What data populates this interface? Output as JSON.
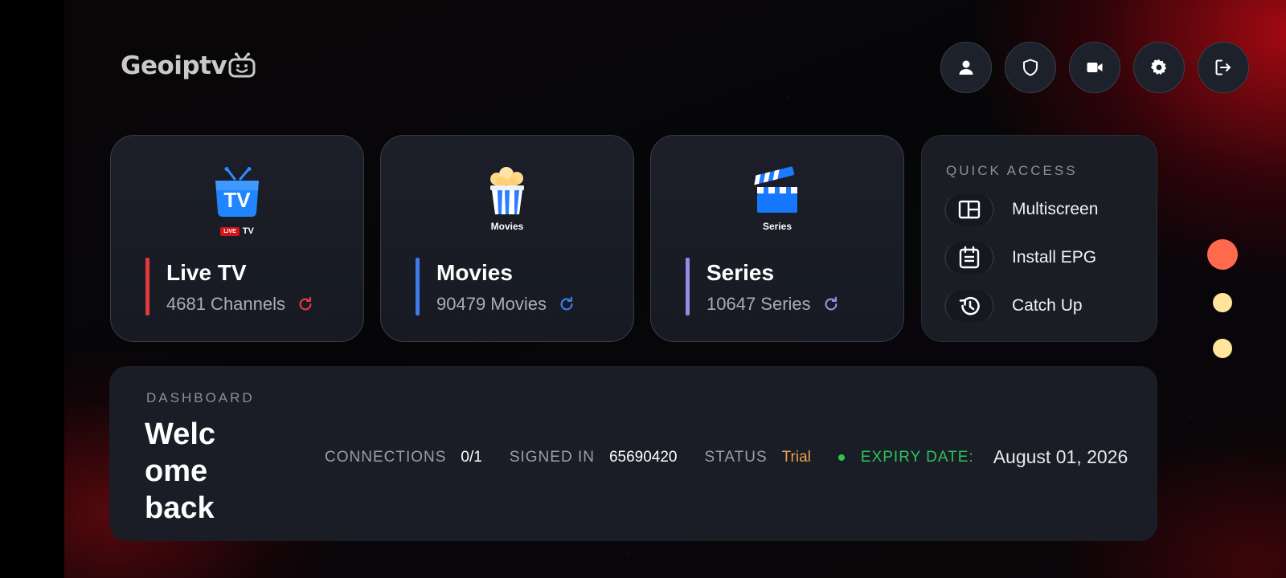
{
  "header": {
    "logo_text": "Geoiptv",
    "icons": [
      "user-icon",
      "shield-icon",
      "video-camera-icon",
      "gear-icon",
      "logout-icon"
    ]
  },
  "categories": [
    {
      "title": "Live TV",
      "count": "4681 Channels",
      "art_label": "TV",
      "badge": "LIVE",
      "accent": "#e0393e",
      "icon": "live-tv-icon"
    },
    {
      "title": "Movies",
      "count": "90479 Movies",
      "art_label": "Movies",
      "accent": "#3f7be8",
      "icon": "popcorn-icon"
    },
    {
      "title": "Series",
      "count": "10647 Series",
      "art_label": "Series",
      "accent": "#9b87e6",
      "icon": "clapperboard-icon"
    }
  ],
  "quick_access": {
    "title": "QUICK ACCESS",
    "items": [
      {
        "label": "Multiscreen",
        "icon": "multiscreen-icon"
      },
      {
        "label": "Install EPG",
        "icon": "calendar-icon"
      },
      {
        "label": "Catch Up",
        "icon": "history-icon"
      }
    ]
  },
  "dashboard": {
    "label": "DASHBOARD",
    "welcome": "Welc ome back",
    "connections_label": "CONNECTIONS",
    "connections_value": "0/1",
    "signed_in_label": "SIGNED IN",
    "signed_in_value": "65690420",
    "status_label": "STATUS",
    "status_value": "Trial",
    "expiry_label": "EXPIRY DATE:",
    "expiry_value": "August 01, 2026"
  },
  "colors": {
    "dot_active": "#ff6a4d",
    "dot_inactive": "#ffe49a",
    "status_trial": "#e6a24a",
    "expiry_green": "#2cc45a"
  }
}
